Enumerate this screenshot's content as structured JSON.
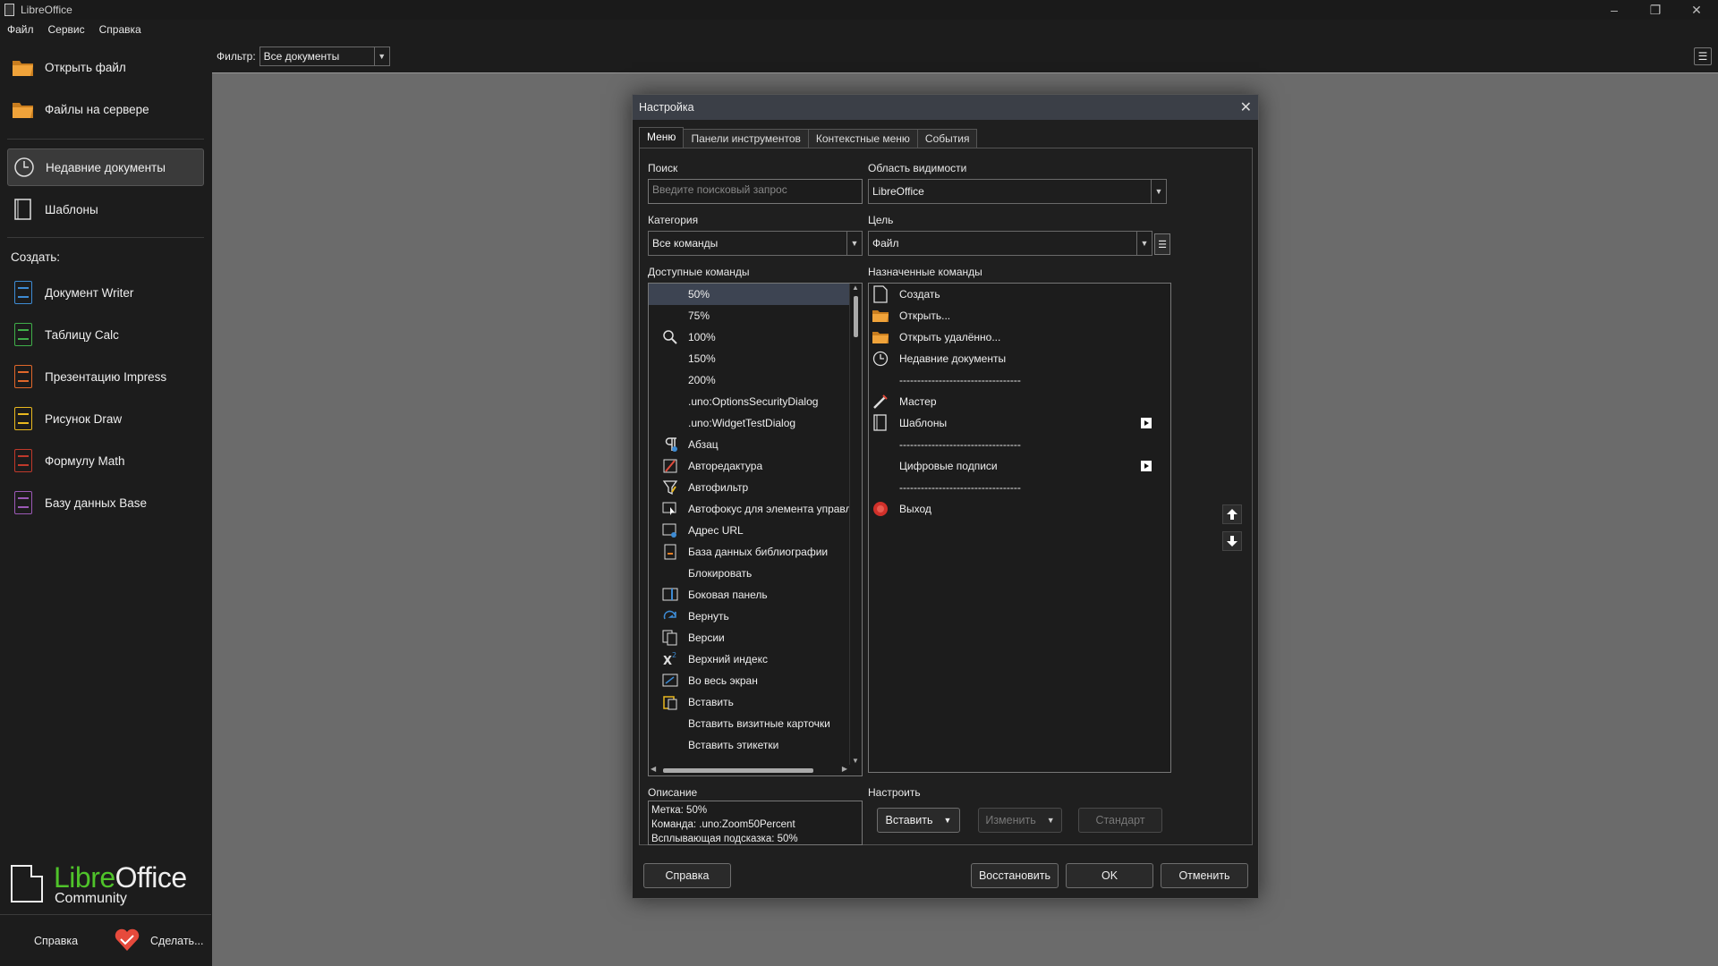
{
  "window": {
    "title": "LibreOffice"
  },
  "menubar": [
    "Файл",
    "Сервис",
    "Справка"
  ],
  "sidebar": {
    "open_file": "Открыть файл",
    "remote_files": "Файлы на сервере",
    "recent_docs": "Недавние документы",
    "templates": "Шаблоны",
    "create_heading": "Создать:",
    "create_items": [
      "Документ Writer",
      "Таблицу Calc",
      "Презентацию Impress",
      "Рисунок Draw",
      "Формулу Math",
      "Базу данных Base"
    ],
    "logo_libre": "Libre",
    "logo_office": "Office",
    "logo_edition": "Community",
    "help": "Справка",
    "donate": "Сделать..."
  },
  "filter": {
    "label": "Фильтр:",
    "value": "Все документы"
  },
  "dialog": {
    "title": "Настройка",
    "tabs": [
      "Меню",
      "Панели инструментов",
      "Контекстные меню",
      "События"
    ],
    "search_label": "Поиск",
    "search_placeholder": "Введите поисковый запрос",
    "category_label": "Категория",
    "category_value": "Все команды",
    "scope_label": "Область видимости",
    "scope_value": "LibreOffice",
    "target_label": "Цель",
    "target_value": "Файл",
    "available_label": "Доступные команды",
    "assigned_label": "Назначенные команды",
    "available_commands": [
      {
        "label": "50%",
        "icon": ""
      },
      {
        "label": "75%",
        "icon": ""
      },
      {
        "label": "100%",
        "icon": "zoom-icon"
      },
      {
        "label": "150%",
        "icon": ""
      },
      {
        "label": "200%",
        "icon": ""
      },
      {
        "label": ".uno:OptionsSecurityDialog",
        "icon": ""
      },
      {
        "label": ".uno:WidgetTestDialog",
        "icon": ""
      },
      {
        "label": "Абзац",
        "icon": "paragraph-icon"
      },
      {
        "label": "Автоpедактура",
        "icon": "autocorrect-icon"
      },
      {
        "label": "Автофильтр",
        "icon": "autofilter-icon"
      },
      {
        "label": "Автофокус для элемента управл",
        "icon": "autofocus-icon"
      },
      {
        "label": "Адрес URL",
        "icon": "url-icon"
      },
      {
        "label": "База данных библиографии",
        "icon": "bibliography-icon"
      },
      {
        "label": "Блокировать",
        "icon": ""
      },
      {
        "label": "Боковая панель",
        "icon": "sidebar-icon"
      },
      {
        "label": "Вернуть",
        "icon": "redo-icon"
      },
      {
        "label": "Версии",
        "icon": "versions-icon"
      },
      {
        "label": "Верхний индекс",
        "icon": "superscript-icon"
      },
      {
        "label": "Во весь экран",
        "icon": "fullscreen-icon"
      },
      {
        "label": "Вставить",
        "icon": "paste-icon"
      },
      {
        "label": "Вставить визитные карточки",
        "icon": ""
      },
      {
        "label": "Вставить этикетки",
        "icon": ""
      }
    ],
    "assigned_commands": [
      {
        "label": "Создать",
        "icon": "new-doc-icon",
        "submenu": false
      },
      {
        "label": "Открыть...",
        "icon": "folder-icon",
        "submenu": false
      },
      {
        "label": "Открыть удалённо...",
        "icon": "folder-icon",
        "submenu": false
      },
      {
        "label": "Недавние документы",
        "icon": "clock-icon",
        "submenu": false
      },
      {
        "label": "----------------------------------",
        "icon": "",
        "submenu": false
      },
      {
        "label": "Мастер",
        "icon": "wizard-icon",
        "submenu": false
      },
      {
        "label": "Шаблоны",
        "icon": "templates-icon",
        "submenu": true
      },
      {
        "label": "----------------------------------",
        "icon": "",
        "submenu": false
      },
      {
        "label": "Цифровые подписи",
        "icon": "",
        "submenu": true
      },
      {
        "label": "----------------------------------",
        "icon": "",
        "submenu": false
      },
      {
        "label": "Выход",
        "icon": "exit-icon",
        "submenu": false
      }
    ],
    "description_label": "Описание",
    "description_lines": [
      "Метка: 50%",
      "Команда: .uno:Zoom50Percent",
      "Всплывающая подсказка: 50%"
    ],
    "customize_label": "Настроить",
    "insert_btn": "Вставить",
    "modify_btn": "Изменить",
    "default_btn": "Стандарт",
    "help_btn": "Справка",
    "reset_btn": "Восстановить",
    "ok_btn": "OK",
    "cancel_btn": "Отменить"
  },
  "colors": {
    "accent_green": "#4fc32a",
    "selection": "#3d4452",
    "dialog_title_bg": "#3b3f47"
  }
}
